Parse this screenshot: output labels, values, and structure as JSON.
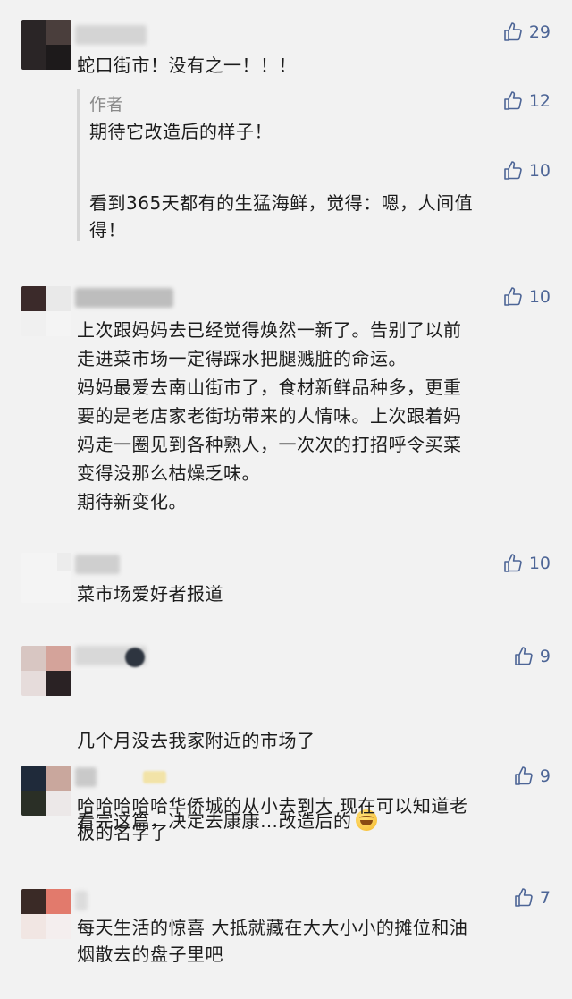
{
  "colors": {
    "background": "#f2f2f2",
    "like": "#4d6596",
    "text": "#1c1c1c",
    "author_tag": "#8a8a8a"
  },
  "comments": [
    {
      "likes": "29",
      "text": "蛇口街市！没有之一！！！",
      "replies": [
        {
          "author": "作者",
          "likes": "12",
          "text": "期待它改造后的样子！"
        },
        {
          "author": "",
          "likes": "10",
          "text": "看到365天都有的生猛海鲜，觉得：嗯，人间值\n得！"
        }
      ]
    },
    {
      "likes": "10",
      "text": "上次跟妈妈去已经觉得焕然一新了。告别了以前\n走进菜市场一定得踩水把腿溅脏的命运。\n妈妈最爱去南山街市了，食材新鲜品种多，更重\n要的是老店家老街坊带来的人情味。上次跟着妈\n妈走一圈见到各种熟人，一次次的打招呼令买菜\n变得没那么枯燥乏味。\n期待新变化。"
    },
    {
      "likes": "10",
      "text": "菜市场爱好者报道"
    },
    {
      "likes": "9",
      "text_line1": "几个月没去我家附近的市场了",
      "text_line2": "看完这篇，决定去康康…改造后的",
      "emoji": "rofl-emoji"
    },
    {
      "likes": "9",
      "text": "哈哈哈哈哈华侨城的从小去到大 现在可以知道老\n板的名字了"
    },
    {
      "likes": "7",
      "text": "每天生活的惊喜 大抵就藏在大大小小的摊位和油\n烟散去的盘子里吧"
    }
  ]
}
